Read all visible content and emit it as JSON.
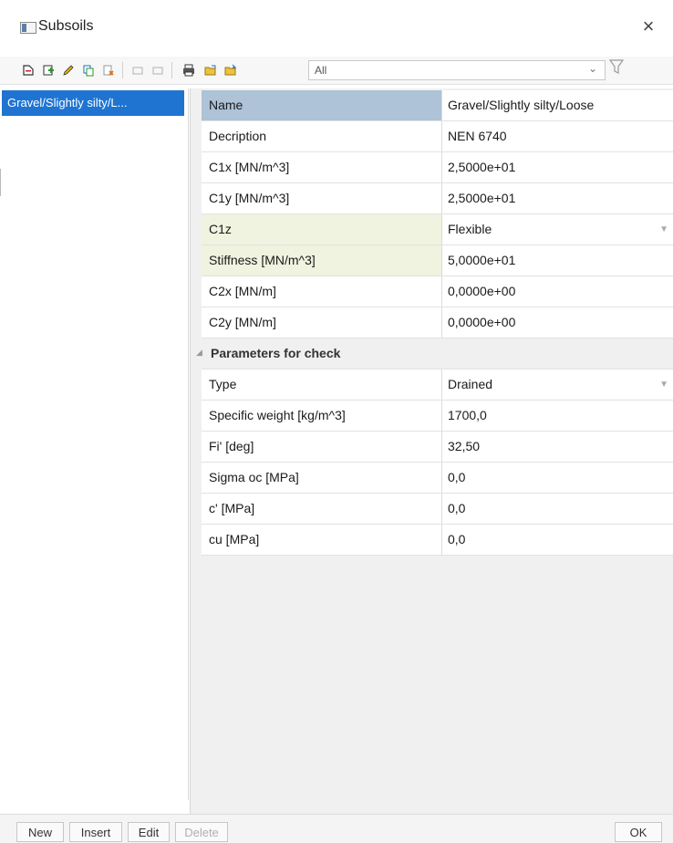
{
  "window": {
    "title": "Subsoils",
    "close_glyph": "×"
  },
  "toolbar": {
    "filter_value": "All",
    "filter_arrow": "⌄",
    "filter_icon": "funnel-icon"
  },
  "list": {
    "selected_item": "Gravel/Slightly silty/L..."
  },
  "properties": {
    "rows": [
      {
        "name": "Name",
        "value": "Gravel/Slightly silty/Loose"
      },
      {
        "name": "Decription",
        "value": "NEN 6740"
      },
      {
        "name": "C1x [MN/m^3]",
        "value": "2,5000e+01"
      },
      {
        "name": "C1y [MN/m^3]",
        "value": "2,5000e+01"
      },
      {
        "name": "C1z",
        "value": "Flexible"
      },
      {
        "name": "Stiffness [MN/m^3]",
        "value": "5,0000e+01"
      },
      {
        "name": "C2x [MN/m]",
        "value": "0,0000e+00"
      },
      {
        "name": "C2y [MN/m]",
        "value": "0,0000e+00"
      }
    ],
    "group": {
      "label": "Parameters for check",
      "rows": [
        {
          "name": "Type",
          "value": "Drained"
        },
        {
          "name": "Specific weight [kg/m^3]",
          "value": "1700,0"
        },
        {
          "name": "Fi' [deg]",
          "value": "32,50"
        },
        {
          "name": "Sigma oc [MPa]",
          "value": "0,0"
        },
        {
          "name": "c' [MPa]",
          "value": "0,0"
        },
        {
          "name": "cu [MPa]",
          "value": "0,0"
        }
      ]
    }
  },
  "buttons": {
    "new": "New",
    "insert": "Insert",
    "edit": "Edit",
    "delete": "Delete",
    "ok": "OK"
  }
}
